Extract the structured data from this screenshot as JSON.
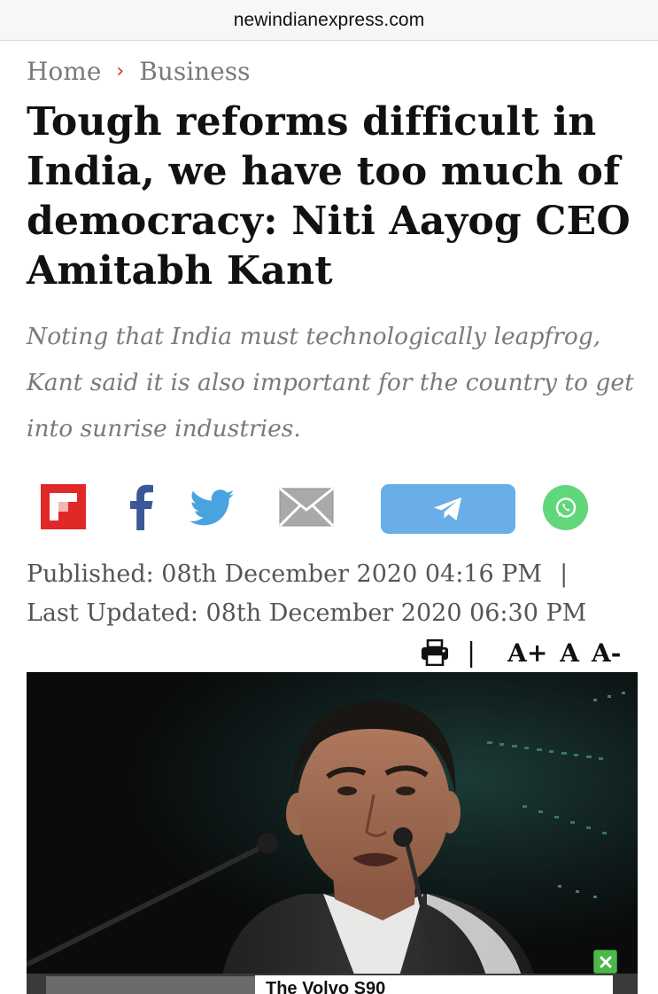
{
  "browser": {
    "url": "newindianexpress.com"
  },
  "breadcrumb": {
    "home": "Home",
    "separator": "›",
    "section": "Business"
  },
  "article": {
    "headline": "Tough reforms difficult in India, we have too much of democracy: Niti Aayog CEO Amitabh Kant",
    "summary": "Noting that India must technologically leapfrog, Kant said it is also important for the country to get into sunrise industries.",
    "published": "Published: 08th December 2020 04:16 PM",
    "published_separator": "|",
    "updated": "Last Updated: 08th December 2020 06:30 PM"
  },
  "share": {
    "icons": [
      "flipboard-icon",
      "facebook-icon",
      "twitter-icon",
      "mail-icon",
      "telegram-icon",
      "whatsapp-icon"
    ]
  },
  "tools": {
    "divider": "|",
    "font_increase": "A+",
    "font_default": "A",
    "font_decrease": "A-"
  },
  "ad": {
    "title": "The Volvo S90"
  },
  "colors": {
    "flipboard": "#e12828",
    "facebook": "#3b5998",
    "twitter": "#4aa3df",
    "telegram": "#69aee6",
    "whatsapp": "#5fd77a",
    "breadcrumb_separator": "#c0392b",
    "ad_close": "#4cb84c"
  }
}
